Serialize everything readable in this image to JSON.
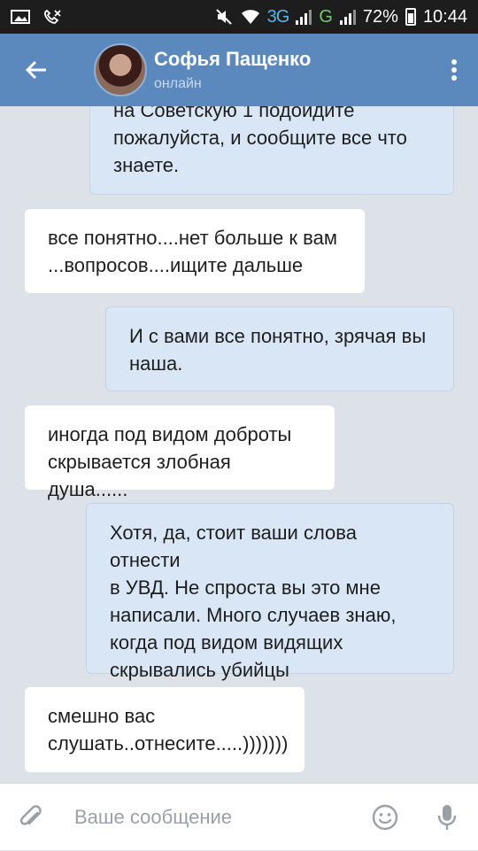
{
  "status_bar": {
    "network_3g": "3G",
    "network_g": "G",
    "battery": "72%",
    "time": "10:44"
  },
  "header": {
    "contact_name": "Софья Пащенко",
    "contact_status": "онлайн"
  },
  "messages": [
    {
      "direction": "out",
      "text": "на Советскую 1 подойдите\nпожалуйста, и сообщите все что\nзнаете."
    },
    {
      "direction": "in",
      "text": "все понятно....нет больше к вам\n...вопросов....ищите дальше"
    },
    {
      "direction": "out",
      "text": "И с вами все понятно, зрячая вы\nнаша."
    },
    {
      "direction": "in",
      "text": "иногда под видом доброты\nскрывается злобная душа......"
    },
    {
      "direction": "out",
      "text": "Хотя, да, стоит ваши слова отнести\nв УВД. Не спроста вы это мне\nнаписали. Много случаев знаю,\nкогда под видом видящих\nскрывались убийцы"
    },
    {
      "direction": "in",
      "text": "смешно вас\nслушать..отнесите.....)))))))"
    }
  ],
  "composer": {
    "placeholder": "Ваше сообщение"
  },
  "colors": {
    "header": "#5b88bd",
    "outgoing_bubble": "#d9e6f5",
    "incoming_bubble": "#ffffff",
    "chat_background": "#dde2e9"
  }
}
